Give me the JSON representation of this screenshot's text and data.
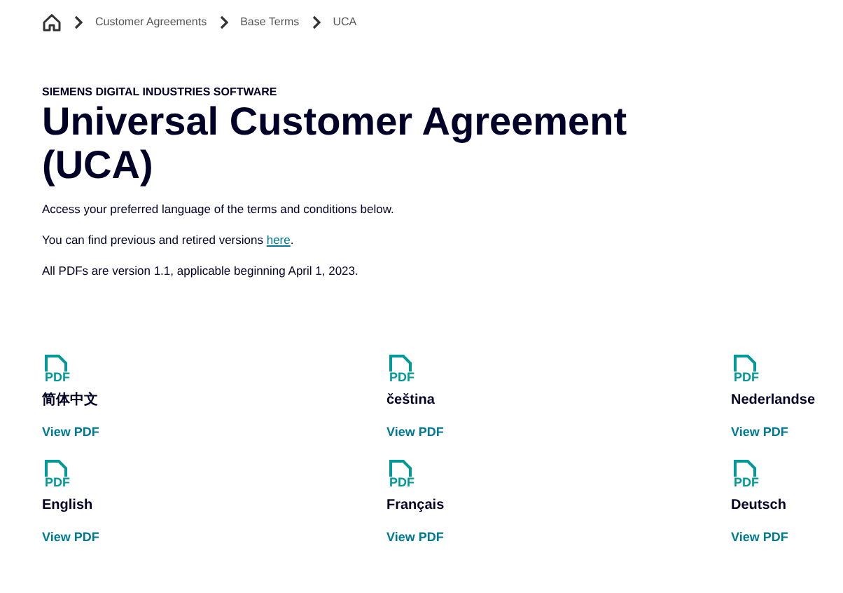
{
  "breadcrumb": [
    "Customer Agreements",
    "Base Terms",
    "UCA"
  ],
  "eyebrow": "SIEMENS DIGITAL INDUSTRIES SOFTWARE",
  "title": "Universal Customer Agreement (UCA)",
  "intro": "Access your preferred language of the terms and conditions below.",
  "versions": {
    "before": "You can find previous and retired versions ",
    "link": "here",
    "after": "."
  },
  "note": "All PDFs are version 1.1, applicable beginning April 1, 2023.",
  "documents": [
    {
      "icon_label": "PDF",
      "language": "简体中文",
      "link": "View PDF"
    },
    {
      "icon_label": "PDF",
      "language": "čeština",
      "link": "View PDF"
    },
    {
      "icon_label": "PDF",
      "language": "Nederlandse",
      "link": "View PDF"
    },
    {
      "icon_label": "PDF",
      "language": "English",
      "link": "View PDF"
    },
    {
      "icon_label": "PDF",
      "language": "Français",
      "link": "View PDF"
    },
    {
      "icon_label": "PDF",
      "language": "Deutsch",
      "link": "View PDF"
    }
  ]
}
